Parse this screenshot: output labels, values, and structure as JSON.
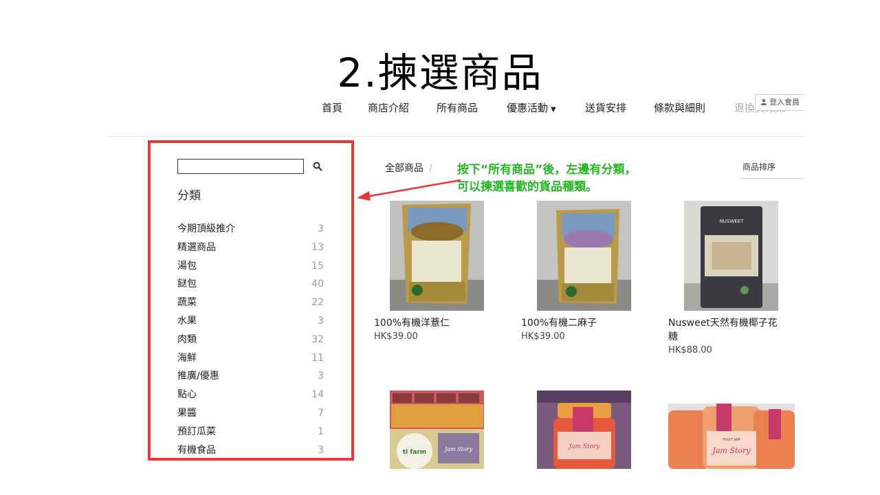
{
  "slide": {
    "title": "2.揀選商品"
  },
  "nav": {
    "items": [
      {
        "label": "首頁"
      },
      {
        "label": "商店介紹"
      },
      {
        "label": "所有商品"
      },
      {
        "label": "優惠活動"
      },
      {
        "label": "送貨安排"
      },
      {
        "label": "條款與細則"
      },
      {
        "label": "退換貨政策"
      }
    ],
    "login": "登入會員"
  },
  "sidebar": {
    "search": {
      "value": "",
      "placeholder": ""
    },
    "heading": "分類",
    "categories": [
      {
        "name": "今期頂級推介",
        "count": "3"
      },
      {
        "name": "精選商品",
        "count": "13"
      },
      {
        "name": "湯包",
        "count": "15"
      },
      {
        "name": "餸包",
        "count": "40"
      },
      {
        "name": "蔬菜",
        "count": "22"
      },
      {
        "name": "水果",
        "count": "3"
      },
      {
        "name": "肉類",
        "count": "32"
      },
      {
        "name": "海鮮",
        "count": "11"
      },
      {
        "name": "推廣/優惠",
        "count": "3"
      },
      {
        "name": "點心",
        "count": "14"
      },
      {
        "name": "果醬",
        "count": "7"
      },
      {
        "name": "預訂瓜菜",
        "count": "1"
      },
      {
        "name": "有機食品",
        "count": "3"
      }
    ]
  },
  "main": {
    "breadcrumb": "全部商品",
    "breadcrumb_sep": "/",
    "annotation": {
      "line1": "按下“所有商品”後，左邊有分類，",
      "line2": "可以揀選喜歡的貨品種類。"
    },
    "sort_label": "商品排序",
    "products": [
      {
        "name": "100%有機洋薏仁",
        "price": "HK$39.00"
      },
      {
        "name": "100%有機二麻子",
        "price": "HK$39.00"
      },
      {
        "name": "Nusweet天然有機椰子花",
        "name2": "糖",
        "price": "HK$88.00"
      }
    ],
    "image_text": {
      "nusweet": "NUSWEET",
      "tifarm": "ti farm",
      "jam1": "Jam Story",
      "jam2": "Jam Story",
      "fruit_jam": "FRUIT JAM"
    }
  },
  "colors": {
    "highlight_border": "#e8373a",
    "annotation_text": "#22b822"
  }
}
